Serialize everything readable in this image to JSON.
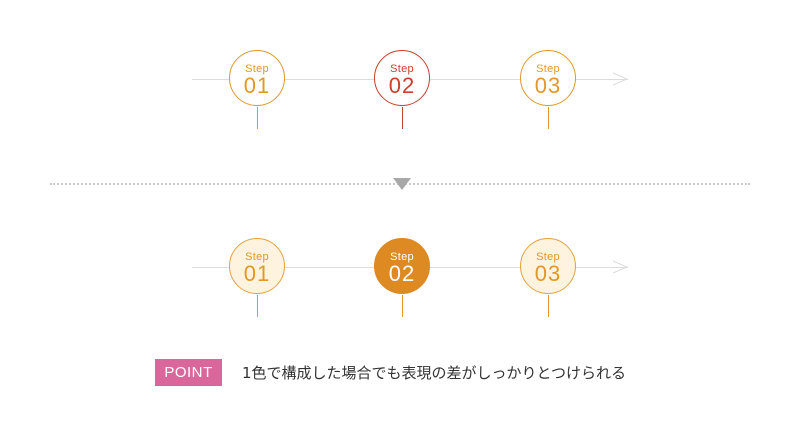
{
  "steps": [
    {
      "label": "Step",
      "number": "01"
    },
    {
      "label": "Step",
      "number": "02"
    },
    {
      "label": "Step",
      "number": "03"
    }
  ],
  "active_step": "02",
  "colors": {
    "orange": "#e1982a",
    "red": "#c9402c",
    "active_fill": "#dd8a22",
    "light_fill": "#fdf3df",
    "point_badge": "#d9679c",
    "line_gray": "#dcdcdc"
  },
  "point": {
    "badge": "POINT",
    "text": "1色で構成した場合でも表現の差がしっかりとつけられる"
  }
}
